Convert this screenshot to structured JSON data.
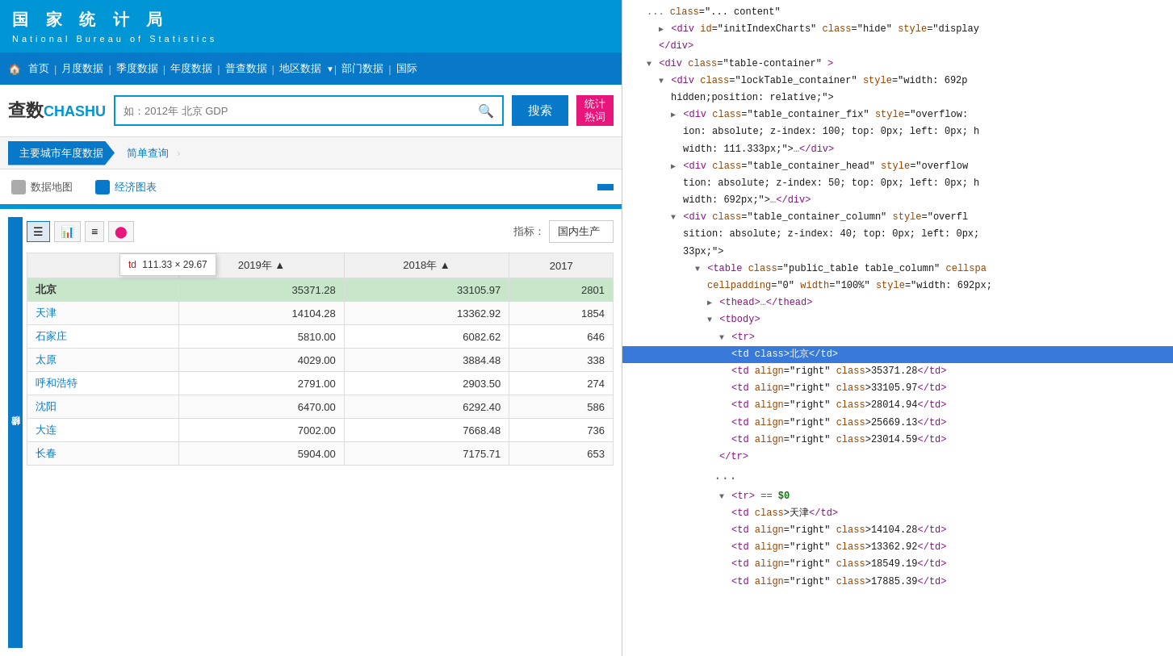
{
  "nbs": {
    "cn_title": "国 家 统 计 局",
    "en_title": "National Bureau of Statistics"
  },
  "nav": {
    "home": "首页",
    "monthly": "月度数据",
    "quarterly": "季度数据",
    "annual": "年度数据",
    "census": "普查数据",
    "regional": "地区数据",
    "dept": "部门数据",
    "intl": "国际"
  },
  "chashu": {
    "logo1": "查数",
    "logo2": "CHASHU",
    "search_placeholder": "如：2012年 北京 GDP",
    "search_btn": "搜索",
    "hot_btn": "统计\n热词"
  },
  "breadcrumb": {
    "main": "主要城市年度数据",
    "sub": "简单查询"
  },
  "second_nav": {
    "map": "数据地图",
    "chart": "经济图表"
  },
  "toolbar": {
    "label": "指标：",
    "value": "国内生产"
  },
  "tooltip": {
    "tag": "td",
    "dimensions": "111.33 × 29.67"
  },
  "table": {
    "headers": [
      "",
      "2019年 ▲",
      "2018年 ▲",
      "2017"
    ],
    "rows": [
      {
        "city": "北京",
        "y2019": "35371.28",
        "y2018": "33105.97",
        "y2017": "2801",
        "highlighted": true
      },
      {
        "city": "天津",
        "y2019": "14104.28",
        "y2018": "13362.92",
        "y2017": "1854"
      },
      {
        "city": "石家庄",
        "y2019": "5810.00",
        "y2018": "6082.62",
        "y2017": "646"
      },
      {
        "city": "太原",
        "y2019": "4029.00",
        "y2018": "3884.48",
        "y2017": "338"
      },
      {
        "city": "呼和浩特",
        "y2019": "2791.00",
        "y2018": "2903.50",
        "y2017": "274"
      },
      {
        "city": "沈阳",
        "y2019": "6470.00",
        "y2018": "6292.40",
        "y2017": "586"
      },
      {
        "city": "大连",
        "y2019": "7002.00",
        "y2018": "7668.48",
        "y2017": "736"
      },
      {
        "city": "长春",
        "y2019": "5904.00",
        "y2018": "7175.71",
        "y2017": "653"
      }
    ]
  },
  "sidebar_label": "经济指标",
  "devtools": {
    "lines": [
      {
        "indent": 1,
        "type": "comment",
        "text": "div class=\"... content\""
      },
      {
        "indent": 2,
        "type": "normal",
        "text": "<div id=\"initIndexCharts\" class=\"hide\" style=\"display"
      },
      {
        "indent": 2,
        "type": "tag",
        "text": "</div>"
      },
      {
        "indent": 1,
        "type": "expand",
        "text": "▼<div class=\"table-container\">"
      },
      {
        "indent": 2,
        "type": "expand",
        "text": "▼<div class=\"lockTable_container\" style=\"width: 692p"
      },
      {
        "indent": 3,
        "text": "hidden;position: relative;\">"
      },
      {
        "indent": 3,
        "type": "collapse",
        "text": "▶<div class=\"table_container_fix\" style=\"overflow:"
      },
      {
        "indent": 4,
        "text": "ion: absolute; z-index: 100; top: 0px; left: 0px; h"
      },
      {
        "indent": 4,
        "text": "width: 111.333px;\">…</div>"
      },
      {
        "indent": 3,
        "type": "collapse",
        "text": "▶<div class=\"table_container_head\" style=\"overflow"
      },
      {
        "indent": 4,
        "text": "tion: absolute; z-index: 50; top: 0px; left: 0px; h"
      },
      {
        "indent": 4,
        "text": "width: 692px;\">…</div>"
      },
      {
        "indent": 3,
        "type": "expand",
        "text": "▼<div class=\"table_container_column\" style=\"overfl"
      },
      {
        "indent": 4,
        "text": "sition: absolute; z-index: 40; top: 0px; left: 0px;"
      },
      {
        "indent": 4,
        "text": "33px;\">"
      },
      {
        "indent": 5,
        "type": "expand",
        "text": "▼<table class=\"public_table table_column\" cellspa"
      },
      {
        "indent": 6,
        "text": "cellpadding=\"0\" width=\"100%\" style=\"width: 692px;"
      },
      {
        "indent": 6,
        "type": "collapse",
        "text": "▶<thead>…</thead>"
      },
      {
        "indent": 6,
        "type": "expand",
        "text": "▼<tbody>"
      },
      {
        "indent": 7,
        "type": "expand",
        "text": "▼<tr>"
      },
      {
        "indent": 8,
        "text": "<td class>北京</td>",
        "highlighted": true
      },
      {
        "indent": 8,
        "text": "<td align=\"right\" class>35371.28</td>"
      },
      {
        "indent": 8,
        "text": "<td align=\"right\" class>33105.97</td>"
      },
      {
        "indent": 8,
        "text": "<td align=\"right\" class>28014.94</td>"
      },
      {
        "indent": 8,
        "text": "<td align=\"right\" class>25669.13</td>"
      },
      {
        "indent": 8,
        "text": "<td align=\"right\" class>23014.59</td>"
      },
      {
        "indent": 7,
        "type": "tag",
        "text": "</tr>"
      },
      {
        "indent": 6,
        "type": "dots",
        "text": "..."
      },
      {
        "indent": 7,
        "type": "expand-marker",
        "text": "▼<tr> == $0"
      },
      {
        "indent": 8,
        "text": "<td class>天津</td>"
      },
      {
        "indent": 8,
        "text": "<td align=\"right\" class>14104.28</td>"
      },
      {
        "indent": 8,
        "text": "<td align=\"right\" class>13362.92</td>"
      },
      {
        "indent": 8,
        "text": "<td align=\"right\" class>18549.19</td>"
      },
      {
        "indent": 8,
        "text": "<td align=\"right\" class>17885.39</td>"
      }
    ]
  }
}
